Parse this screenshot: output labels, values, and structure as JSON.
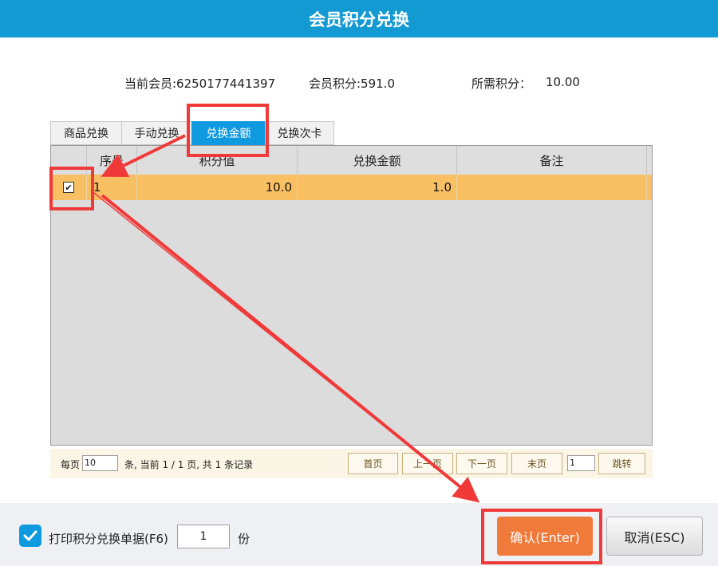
{
  "window": {
    "title": "会员积分兑换"
  },
  "member_info": {
    "current_member": "当前会员:6250177441397",
    "member_points": "会员积分:591.0",
    "required_points_label": "所需积分：",
    "required_points_value": "10.00"
  },
  "tabs": [
    {
      "label": "商品兑换",
      "active": false
    },
    {
      "label": "手动兑换",
      "active": false
    },
    {
      "label": "兑换金额",
      "active": true
    },
    {
      "label": "兑换次卡",
      "active": false
    }
  ],
  "table": {
    "columns": [
      "序号",
      "积分值",
      "兑换金额",
      "备注"
    ],
    "rows": [
      {
        "checked": true,
        "seq": "1",
        "points": "10.0",
        "amount": "1.0",
        "remark": ""
      }
    ]
  },
  "pager": {
    "per_page_label": "每页",
    "per_page_value": "10",
    "status_text": "条, 当前 1 / 1 页, 共 1 条记录",
    "first": "首页",
    "prev": "上一页",
    "next": "下一页",
    "last": "末页",
    "jump_value": "1",
    "jump": "跳转"
  },
  "footer": {
    "print_checked": true,
    "print_label": "打印积分兑换单据(F6)",
    "copies": "1",
    "copies_unit": "份",
    "confirm": "确认(Enter)",
    "cancel": "取消(ESC)"
  },
  "colors": {
    "title_bar": "#139ad3",
    "active_tab": "#0f9ae0",
    "selected_row": "#f8c063",
    "confirm_button": "#f07a3a",
    "annotation": "#f03a3a"
  }
}
